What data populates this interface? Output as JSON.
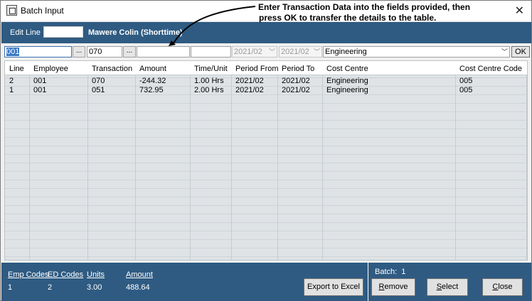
{
  "window": {
    "title": "Batch Input",
    "close_symbol": "✕"
  },
  "annotation": {
    "line1": "Enter Transaction Data into the fields provided, then",
    "line2": "press OK to transfer the details to the table."
  },
  "edit_bar": {
    "label": "Edit Line",
    "value": "",
    "employee_name": "Mawere Colin (Shorttime)"
  },
  "input_row": {
    "employee": "001",
    "transaction": "070",
    "amount": "",
    "time_unit": "",
    "period_from": "2021/02",
    "period_to": "2021/02",
    "cost_centre": "Engineering",
    "lookup_label": "...",
    "ok_label": "OK"
  },
  "table": {
    "headers": [
      "Line",
      "Employee",
      "Transaction",
      "Amount",
      "Time/Unit",
      "Period From",
      "Period To",
      "Cost Centre",
      "Cost Centre Code"
    ],
    "rows": [
      [
        "2",
        "001",
        "070",
        "-244.32",
        "1.00 Hrs",
        "2021/02",
        "2021/02",
        "Engineering",
        "005"
      ],
      [
        "1",
        "001",
        "051",
        "732.95",
        "2.00 Hrs",
        "2021/02",
        "2021/02",
        "Engineering",
        "005"
      ]
    ]
  },
  "summary": {
    "emp_codes_label": "Emp Codes",
    "emp_codes": "1",
    "ed_codes_label": "ED Codes",
    "ed_codes": "2",
    "units_label": "Units",
    "units": "3.00",
    "amount_label": "Amount",
    "amount": "488.64"
  },
  "batch": {
    "label": "Batch:",
    "value": "1"
  },
  "buttons": {
    "export": "Export to Excel",
    "remove": "Remove",
    "select": "Select",
    "close": "Close"
  },
  "colors": {
    "accent": "#2f5b82",
    "focus": "#3a78c4"
  }
}
